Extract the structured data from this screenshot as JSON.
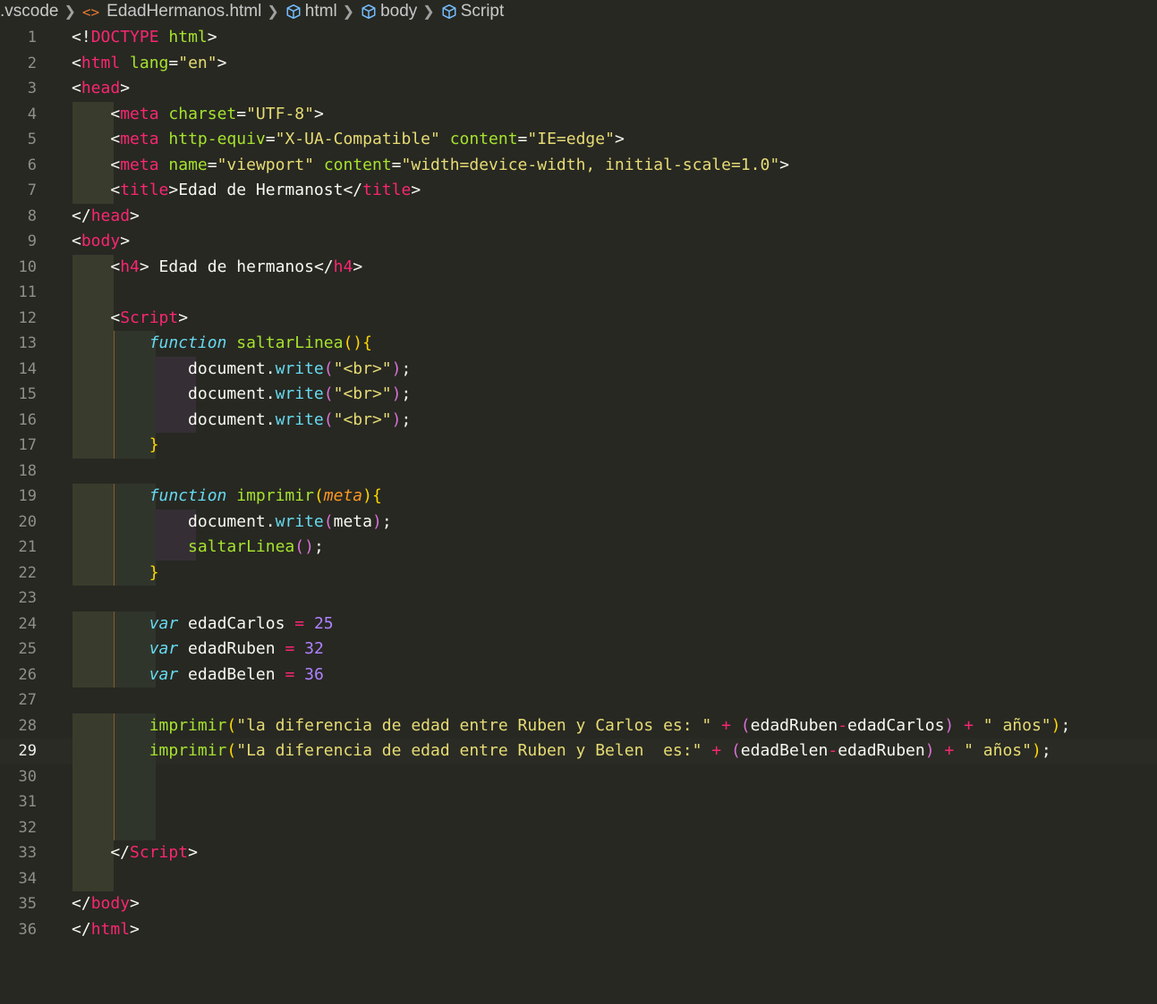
{
  "breadcrumb": {
    "items": [
      {
        "label": ".vscode",
        "icon": ""
      },
      {
        "label": "EdadHermanos.html",
        "icon": "html-file-icon"
      },
      {
        "label": "html",
        "icon": "symbol-element-icon"
      },
      {
        "label": "body",
        "icon": "symbol-element-icon"
      },
      {
        "label": "Script",
        "icon": "symbol-element-icon"
      }
    ]
  },
  "editor": {
    "current_line": 29,
    "colors": {
      "background": "#272822",
      "tag": "#f92672",
      "attribute": "#a6e22e",
      "string": "#e6db74",
      "keyword": "#66d9ef",
      "number": "#ae81ff",
      "parameter": "#fd971f"
    },
    "lines": [
      {
        "n": "1",
        "g": 0,
        "tokens": [
          [
            "t",
            "<!"
          ],
          [
            "tag",
            "DOCTYPE"
          ],
          [
            "t",
            " "
          ],
          [
            "attr",
            "html"
          ],
          [
            "t",
            ">"
          ]
        ]
      },
      {
        "n": "2",
        "g": 0,
        "tokens": [
          [
            "t",
            "<"
          ],
          [
            "tag",
            "html"
          ],
          [
            "t",
            " "
          ],
          [
            "attr",
            "lang"
          ],
          [
            "t",
            "="
          ],
          [
            "str",
            "\"en\""
          ],
          [
            "t",
            ">"
          ]
        ]
      },
      {
        "n": "3",
        "g": 0,
        "tokens": [
          [
            "t",
            "<"
          ],
          [
            "tag",
            "head"
          ],
          [
            "t",
            ">"
          ]
        ]
      },
      {
        "n": "4",
        "g": 1,
        "tokens": [
          [
            "t",
            "    <"
          ],
          [
            "tag",
            "meta"
          ],
          [
            "t",
            " "
          ],
          [
            "attr",
            "charset"
          ],
          [
            "t",
            "="
          ],
          [
            "str",
            "\"UTF-8\""
          ],
          [
            "t",
            ">"
          ]
        ]
      },
      {
        "n": "5",
        "g": 1,
        "tokens": [
          [
            "t",
            "    <"
          ],
          [
            "tag",
            "meta"
          ],
          [
            "t",
            " "
          ],
          [
            "attr",
            "http-equiv"
          ],
          [
            "t",
            "="
          ],
          [
            "str",
            "\"X-UA-Compatible\""
          ],
          [
            "t",
            " "
          ],
          [
            "attr",
            "content"
          ],
          [
            "t",
            "="
          ],
          [
            "str",
            "\"IE=edge\""
          ],
          [
            "t",
            ">"
          ]
        ]
      },
      {
        "n": "6",
        "g": 1,
        "tokens": [
          [
            "t",
            "    <"
          ],
          [
            "tag",
            "meta"
          ],
          [
            "t",
            " "
          ],
          [
            "attr",
            "name"
          ],
          [
            "t",
            "="
          ],
          [
            "str",
            "\"viewport\""
          ],
          [
            "t",
            " "
          ],
          [
            "attr",
            "content"
          ],
          [
            "t",
            "="
          ],
          [
            "str",
            "\"width=device-width, initial-scale=1.0\""
          ],
          [
            "t",
            ">"
          ]
        ]
      },
      {
        "n": "7",
        "g": 1,
        "tokens": [
          [
            "t",
            "    <"
          ],
          [
            "tag",
            "title"
          ],
          [
            "t",
            ">Edad de Hermanost</"
          ],
          [
            "tag",
            "title"
          ],
          [
            "t",
            ">"
          ]
        ]
      },
      {
        "n": "8",
        "g": 0,
        "tokens": [
          [
            "t",
            "</"
          ],
          [
            "tag",
            "head"
          ],
          [
            "t",
            ">"
          ]
        ]
      },
      {
        "n": "9",
        "g": 0,
        "tokens": [
          [
            "t",
            "<"
          ],
          [
            "tag",
            "body"
          ],
          [
            "t",
            ">"
          ]
        ]
      },
      {
        "n": "10",
        "g": 1,
        "tokens": [
          [
            "t",
            "    <"
          ],
          [
            "tag",
            "h4"
          ],
          [
            "t",
            "> Edad de hermanos</"
          ],
          [
            "tag",
            "h4"
          ],
          [
            "t",
            ">"
          ]
        ]
      },
      {
        "n": "11",
        "g": 1,
        "tokens": []
      },
      {
        "n": "12",
        "g": 1,
        "tokens": [
          [
            "t",
            "    <"
          ],
          [
            "tag",
            "Script"
          ],
          [
            "t",
            ">"
          ]
        ]
      },
      {
        "n": "13",
        "g": 2,
        "tokens": [
          [
            "t",
            "        "
          ],
          [
            "kw",
            "function"
          ],
          [
            "t",
            " "
          ],
          [
            "fn",
            "saltarLinea"
          ],
          [
            "br1",
            "(){"
          ]
        ]
      },
      {
        "n": "14",
        "g": 3,
        "tokens": [
          [
            "t",
            "            document."
          ],
          [
            "method",
            "write"
          ],
          [
            "br2",
            "("
          ],
          [
            "str",
            "\"<br>\""
          ],
          [
            "br2",
            ")"
          ],
          [
            "t",
            ";"
          ]
        ]
      },
      {
        "n": "15",
        "g": 3,
        "tokens": [
          [
            "t",
            "            document."
          ],
          [
            "method",
            "write"
          ],
          [
            "br2",
            "("
          ],
          [
            "str",
            "\"<br>\""
          ],
          [
            "br2",
            ")"
          ],
          [
            "t",
            ";"
          ]
        ]
      },
      {
        "n": "16",
        "g": 3,
        "tokens": [
          [
            "t",
            "            document."
          ],
          [
            "method",
            "write"
          ],
          [
            "br2",
            "("
          ],
          [
            "str",
            "\"<br>\""
          ],
          [
            "br2",
            ")"
          ],
          [
            "t",
            ";"
          ]
        ]
      },
      {
        "n": "17",
        "g": 2,
        "tokens": [
          [
            "t",
            "        "
          ],
          [
            "br1",
            "}"
          ]
        ]
      },
      {
        "n": "18",
        "g": 0,
        "tokens": []
      },
      {
        "n": "19",
        "g": 2,
        "tokens": [
          [
            "t",
            "        "
          ],
          [
            "kw",
            "function"
          ],
          [
            "t",
            " "
          ],
          [
            "fn",
            "imprimir"
          ],
          [
            "br1",
            "("
          ],
          [
            "param",
            "meta"
          ],
          [
            "br1",
            "){"
          ]
        ]
      },
      {
        "n": "20",
        "g": 3,
        "tokens": [
          [
            "t",
            "            document."
          ],
          [
            "method",
            "write"
          ],
          [
            "br2",
            "("
          ],
          [
            "t",
            "meta"
          ],
          [
            "br2",
            ")"
          ],
          [
            "t",
            ";"
          ]
        ]
      },
      {
        "n": "21",
        "g": 3,
        "tokens": [
          [
            "t",
            "            "
          ],
          [
            "fn",
            "saltarLinea"
          ],
          [
            "br2",
            "()"
          ],
          [
            "t",
            ";"
          ]
        ]
      },
      {
        "n": "22",
        "g": 2,
        "tokens": [
          [
            "t",
            "        "
          ],
          [
            "br1",
            "}"
          ]
        ]
      },
      {
        "n": "23",
        "g": 0,
        "tokens": []
      },
      {
        "n": "24",
        "g": 2,
        "tokens": [
          [
            "t",
            "        "
          ],
          [
            "kw",
            "var"
          ],
          [
            "t",
            " edadCarlos "
          ],
          [
            "op",
            "="
          ],
          [
            "t",
            " "
          ],
          [
            "num",
            "25"
          ]
        ]
      },
      {
        "n": "25",
        "g": 2,
        "tokens": [
          [
            "t",
            "        "
          ],
          [
            "kw",
            "var"
          ],
          [
            "t",
            " edadRuben "
          ],
          [
            "op",
            "="
          ],
          [
            "t",
            " "
          ],
          [
            "num",
            "32"
          ]
        ]
      },
      {
        "n": "26",
        "g": 2,
        "tokens": [
          [
            "t",
            "        "
          ],
          [
            "kw",
            "var"
          ],
          [
            "t",
            " edadBelen "
          ],
          [
            "op",
            "="
          ],
          [
            "t",
            " "
          ],
          [
            "num",
            "36"
          ]
        ]
      },
      {
        "n": "27",
        "g": 0,
        "tokens": []
      },
      {
        "n": "28",
        "g": 2,
        "tokens": [
          [
            "t",
            "        "
          ],
          [
            "fn",
            "imprimir"
          ],
          [
            "br1",
            "("
          ],
          [
            "str",
            "\"la diferencia de edad entre Ruben y Carlos es: \""
          ],
          [
            "t",
            " "
          ],
          [
            "op",
            "+"
          ],
          [
            "t",
            " "
          ],
          [
            "br2",
            "("
          ],
          [
            "t",
            "edadRuben"
          ],
          [
            "op",
            "-"
          ],
          [
            "t",
            "edadCarlos"
          ],
          [
            "br2",
            ")"
          ],
          [
            "t",
            " "
          ],
          [
            "op",
            "+"
          ],
          [
            "t",
            " "
          ],
          [
            "str",
            "\" años\""
          ],
          [
            "br1",
            ")"
          ],
          [
            "t",
            ";"
          ]
        ]
      },
      {
        "n": "29",
        "g": 2,
        "tokens": [
          [
            "t",
            "        "
          ],
          [
            "fn",
            "imprimir"
          ],
          [
            "br1",
            "("
          ],
          [
            "str",
            "\"La diferencia de edad entre Ruben y Belen  es:\""
          ],
          [
            "t",
            " "
          ],
          [
            "op",
            "+"
          ],
          [
            "t",
            " "
          ],
          [
            "br2",
            "("
          ],
          [
            "t",
            "edadBelen"
          ],
          [
            "op",
            "-"
          ],
          [
            "t",
            "edadRuben"
          ],
          [
            "br2",
            ")"
          ],
          [
            "t",
            " "
          ],
          [
            "op",
            "+"
          ],
          [
            "t",
            " "
          ],
          [
            "str",
            "\" años\""
          ],
          [
            "br1",
            ")"
          ],
          [
            "t",
            ";"
          ]
        ]
      },
      {
        "n": "30",
        "g": 2,
        "tokens": []
      },
      {
        "n": "31",
        "g": 2,
        "tokens": []
      },
      {
        "n": "32",
        "g": 2,
        "tokens": []
      },
      {
        "n": "33",
        "g": 1,
        "tokens": [
          [
            "t",
            "    </"
          ],
          [
            "tag",
            "Script"
          ],
          [
            "t",
            ">"
          ]
        ]
      },
      {
        "n": "34",
        "g": 1,
        "tokens": []
      },
      {
        "n": "35",
        "g": 0,
        "tokens": [
          [
            "t",
            "</"
          ],
          [
            "tag",
            "body"
          ],
          [
            "t",
            ">"
          ]
        ]
      },
      {
        "n": "36",
        "g": 0,
        "tokens": [
          [
            "t",
            "</"
          ],
          [
            "tag",
            "html"
          ],
          [
            "t",
            ">"
          ]
        ]
      }
    ]
  }
}
